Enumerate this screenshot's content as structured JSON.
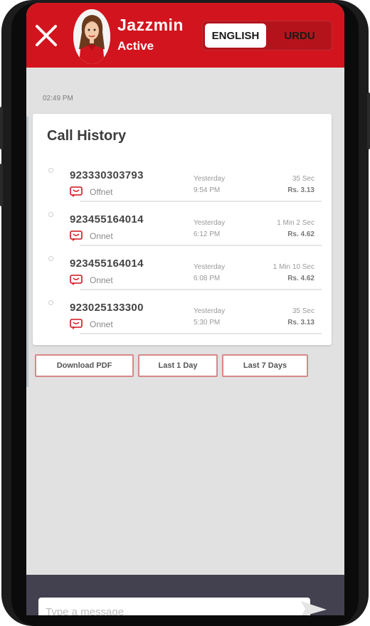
{
  "header": {
    "agent_name": "Jazzmin",
    "agent_status": "Active",
    "languages": [
      "ENGLISH",
      "URDU"
    ],
    "selected_language": "ENGLISH",
    "accent_color": "#d1141d"
  },
  "chat": {
    "timestamp": "02:49 PM"
  },
  "call_history": {
    "title": "Call History",
    "rows": [
      {
        "number": "923330303793",
        "network": "Offnet",
        "day": "Yesterday",
        "time": "9:54 PM",
        "duration": "35 Sec",
        "cost": "Rs. 3.13"
      },
      {
        "number": "923455164014",
        "network": "Onnet",
        "day": "Yesterday",
        "time": "6:12 PM",
        "duration": "1 Min 2 Sec",
        "cost": "Rs. 4.62"
      },
      {
        "number": "923455164014",
        "network": "Onnet",
        "day": "Yesterday",
        "time": "6:08 PM",
        "duration": "1 Min 10 Sec",
        "cost": "Rs. 4.62"
      },
      {
        "number": "923025133300",
        "network": "Onnet",
        "day": "Yesterday",
        "time": "5:30 PM",
        "duration": "35 Sec",
        "cost": "Rs. 3.13"
      }
    ]
  },
  "quick_replies": [
    "Download PDF",
    "Last 1 Day",
    "Last 7 Days"
  ],
  "composer": {
    "placeholder": "Type a message",
    "value": ""
  },
  "icons": {
    "close": "close-icon",
    "send": "send-icon",
    "call_type": "call-type-icon",
    "avatar": "avatar"
  }
}
